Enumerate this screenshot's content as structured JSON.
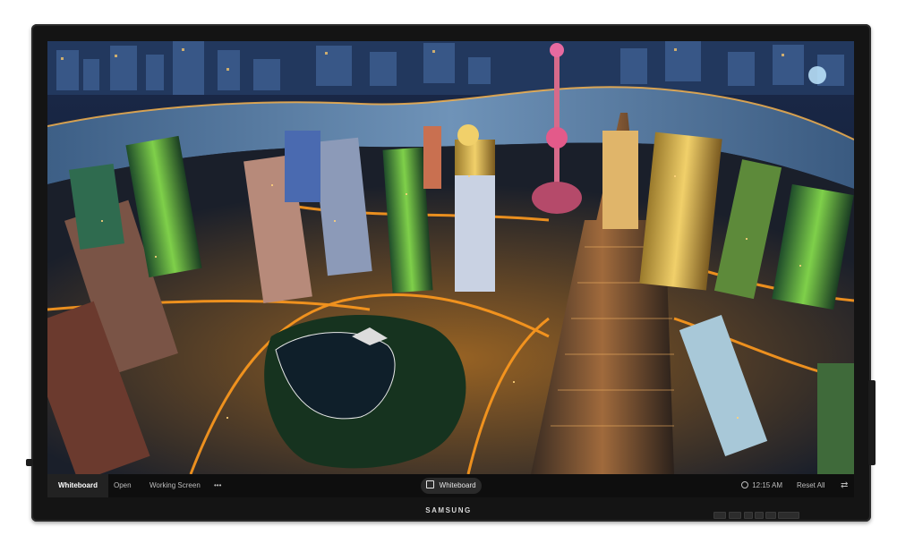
{
  "device": {
    "brand": "SAMSUNG"
  },
  "taskbar": {
    "items": [
      {
        "label": "Whiteboard",
        "active": true
      },
      {
        "label": "Open"
      },
      {
        "label": "Working Screen"
      },
      {
        "label": "•••"
      }
    ],
    "center_button": {
      "label": "Whiteboard",
      "icon": "pen-edit-icon"
    },
    "clock": {
      "time": "12:15 AM",
      "icon": "clock-icon"
    },
    "reset_label": "Reset All",
    "switch_icon": "swap-arrows-icon"
  },
  "colors": {
    "bezel": "#141414",
    "taskbar": "#0e0e0e",
    "highlight_orange": "#ff9a1e",
    "river": "#5a7fa3"
  }
}
